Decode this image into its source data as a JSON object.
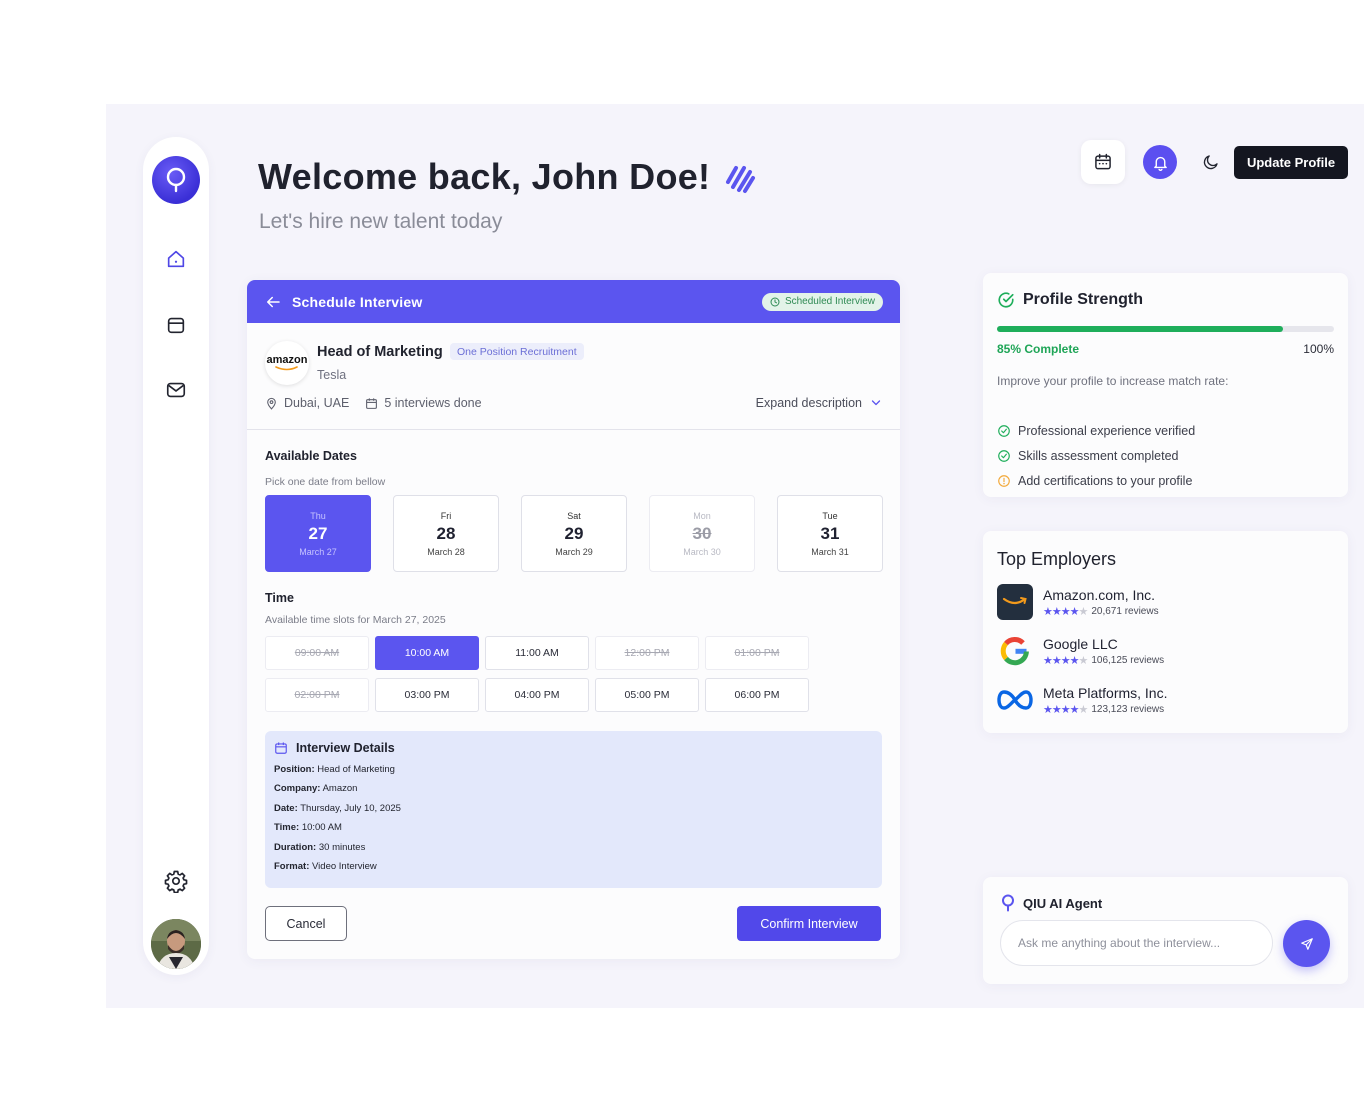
{
  "header": {
    "welcome": "Welcome back, John Doe!",
    "subtitle": "Let's hire new talent today",
    "update_profile_label": "Update Profile"
  },
  "sidebar": {
    "items": [
      {
        "name": "home",
        "icon": "home-icon"
      },
      {
        "name": "calendar",
        "icon": "calendar-icon"
      },
      {
        "name": "mail",
        "icon": "mail-icon"
      }
    ],
    "settings_icon": "gear-icon"
  },
  "schedule": {
    "title": "Schedule Interview",
    "status_badge": "Scheduled Interview",
    "job": {
      "logo_text": "amazon",
      "title": "Head of Marketing",
      "tag": "One Position Recruitment",
      "company": "Tesla",
      "location": "Dubai, UAE",
      "interviews": "5 interviews done",
      "expand_label": "Expand description"
    },
    "dates_title": "Available Dates",
    "dates_sub": "Pick one date from bellow",
    "dates": [
      {
        "dow": "Thu",
        "num": "27",
        "label": "March 27",
        "state": "selected"
      },
      {
        "dow": "Fri",
        "num": "28",
        "label": "March 28",
        "state": "available"
      },
      {
        "dow": "Sat",
        "num": "29",
        "label": "March 29",
        "state": "available"
      },
      {
        "dow": "Mon",
        "num": "30",
        "label": "March 30",
        "state": "disabled"
      },
      {
        "dow": "Tue",
        "num": "31",
        "label": "March 31",
        "state": "available"
      }
    ],
    "time_title": "Time",
    "time_sub": "Available time slots for March 27, 2025",
    "slots": [
      {
        "label": "09:00 AM",
        "state": "disabled"
      },
      {
        "label": "10:00 AM",
        "state": "selected"
      },
      {
        "label": "11:00 AM",
        "state": "available"
      },
      {
        "label": "12:00 PM",
        "state": "disabled"
      },
      {
        "label": "01:00 PM",
        "state": "disabled"
      },
      {
        "label": "02:00 PM",
        "state": "disabled"
      },
      {
        "label": "03:00 PM",
        "state": "available"
      },
      {
        "label": "04:00 PM",
        "state": "available"
      },
      {
        "label": "05:00 PM",
        "state": "available"
      },
      {
        "label": "06:00 PM",
        "state": "available"
      }
    ],
    "details": {
      "title": "Interview Details",
      "rows": [
        {
          "k": "Position:",
          "v": "Head of Marketing"
        },
        {
          "k": "Company:",
          "v": "Amazon"
        },
        {
          "k": "Date:",
          "v": "Thursday, July 10, 2025"
        },
        {
          "k": "Time:",
          "v": "10:00 AM"
        },
        {
          "k": "Duration:",
          "v": "30 minutes"
        },
        {
          "k": "Format:",
          "v": "Video Interview"
        }
      ]
    },
    "cancel_label": "Cancel",
    "confirm_label": "Confirm Interview"
  },
  "profile_strength": {
    "title": "Profile Strength",
    "progress": 0.85,
    "complete_label": "85% Complete",
    "max_label": "100%",
    "improve_text": "Improve your profile to increase match rate:",
    "checks": [
      {
        "text": "Professional experience verified",
        "status": "done"
      },
      {
        "text": "Skills assessment completed",
        "status": "done"
      },
      {
        "text": "Add certifications to your profile",
        "status": "pending"
      }
    ],
    "colors": {
      "done": "#1fae5b",
      "pending": "#f2a93b",
      "bar": "#1fae5b"
    }
  },
  "top_employers": {
    "title": "Top Employers",
    "items": [
      {
        "name": "Amazon.com, Inc.",
        "rating": 4,
        "reviews": "20,671 reviews",
        "logo": "amazon-logo"
      },
      {
        "name": "Google LLC",
        "rating": 4,
        "reviews": "106,125 reviews",
        "logo": "google-logo"
      },
      {
        "name": "Meta Platforms, Inc.",
        "rating": 4,
        "reviews": "123,123 reviews",
        "logo": "meta-logo"
      }
    ]
  },
  "agent": {
    "title": "QIU AI Agent",
    "placeholder": "Ask me anything about the interview..."
  },
  "colors": {
    "accent": "#5b55ef",
    "dark": "#141620",
    "bg": "#f5f4fb"
  }
}
